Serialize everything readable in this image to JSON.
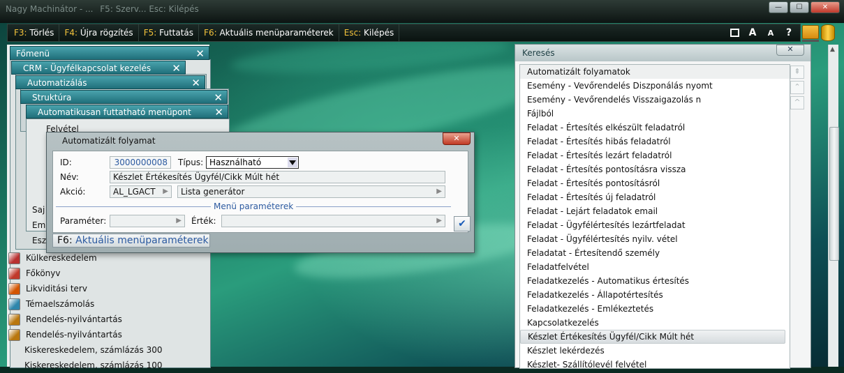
{
  "window": {
    "title": "Nagy Machinátor - ...",
    "subtitle": "F5: Szerv... Esc: Kilépés"
  },
  "fkeybar": {
    "keys": [
      {
        "key": "F3:",
        "label": "Törlés"
      },
      {
        "key": "F4:",
        "label": "Újra rögzítés"
      },
      {
        "key": "F5:",
        "label": "Futtatás"
      },
      {
        "key": "F6:",
        "label": "Aktuális menüparaméterek"
      },
      {
        "key": "Esc:",
        "label": "Kilépés"
      }
    ],
    "right_icons": [
      "window-icon",
      "font-larger-icon",
      "font-smaller-icon",
      "help-icon"
    ],
    "font_large": "A",
    "font_small": "A",
    "help": "?"
  },
  "left_windows": {
    "fomenu": "Főmenü",
    "crm": "CRM - Ügyfélkapcsolat kezelés",
    "automatizalas": "Automatizálás",
    "struktura": "Struktúra",
    "automatikus": "Automatikusan futtatható menüpont",
    "felvetel": "Felvétel",
    "side_texts": [
      "Saj",
      "Em",
      "Esz"
    ],
    "menu_items": [
      {
        "label": "Külkereskedelem",
        "color": "#b83030"
      },
      {
        "label": "Főkönyv",
        "color": "#c0392b"
      },
      {
        "label": "Likviditási terv",
        "color": "#d35400"
      },
      {
        "label": "Témaelszámolás",
        "color": "#2e86ab"
      },
      {
        "label": "Rendelés-nyilvántartás",
        "color": "#b9770e"
      },
      {
        "label": "Rendelés-nyilvántartás",
        "color": "#b9770e"
      },
      {
        "label": "Kiskereskedelem, számlázás 300",
        "color": ""
      },
      {
        "label": "Kiskereskedelem, számlázás 100",
        "color": ""
      }
    ]
  },
  "dialog": {
    "title": "Automatizált folyamat",
    "id_label": "ID:",
    "id_value": "3000000008",
    "tipus_label": "Típus:",
    "tipus_value": "Használható",
    "nev_label": "Név:",
    "nev_value": "Készlet Értékesítés Ügyfél/Cikk Múlt hét",
    "akcio_label": "Akció:",
    "akcio_code": "AL_LGACT",
    "akcio_name": "Lista generátor",
    "section_label": "Menü paraméterek",
    "parameter_label": "Paraméter:",
    "ertek_label": "Érték:",
    "f6_key": "F6:",
    "f6_label": "Aktuális menüparaméterek"
  },
  "search": {
    "title": "Keresés",
    "items": [
      "Automatizált folyamatok",
      "Esemény - Vevőrendelés Diszponálás nyomt",
      "Esemény - Vevőrendelés Visszaigazolás  n",
      "Fájlból",
      "Feladat - Értesítés elkészült feladatról",
      "Feladat - Értesítés hibás feladatról",
      "Feladat - Értesítés lezárt feladatról",
      "Feladat - Értesítés pontosításra vissza",
      "Feladat - Értesítés pontosításról",
      "Feladat - Értesítés új feladatról",
      "Feladat - Lejárt feladatok email",
      "Feladat - Ügyfélértesítés lezártfeladat",
      "Feladat - Ügyfélértesítés nyilv. vétel",
      "Feladatat - Értesítendő személy",
      "Feladatfelvétel",
      "Feladatkezelés - Automatikus értesítés",
      "Feladatkezelés - Állapotértesítés",
      "Feladatkezelés - Emlékeztetés",
      "Kapcsolatkezelés",
      "Készlet Értékesítés Ügyfél/Cikk Múlt hét",
      "Készlet lekérdezés",
      "Készlet- Szállítólevél felvétel"
    ],
    "selected_index": 19
  },
  "colors": {
    "accent": "#1f6f7a",
    "fkey": "#f3c23a",
    "link": "#2c5aa0"
  }
}
